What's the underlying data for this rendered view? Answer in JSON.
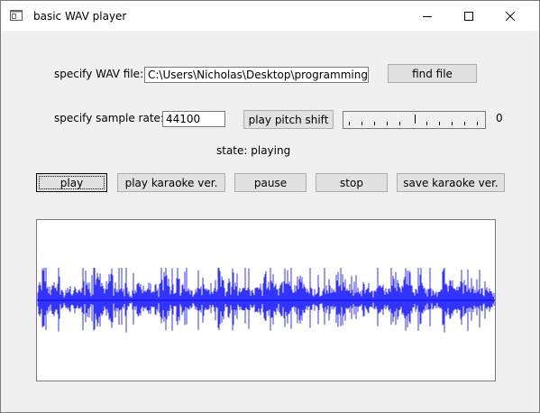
{
  "window": {
    "title": "basic WAV player",
    "controls": [
      "minimize-icon",
      "maximize-icon",
      "close-icon"
    ]
  },
  "file_row": {
    "label": "specify WAV file:",
    "path_value": "C:\\Users\\Nicholas\\Desktop\\programming\\b",
    "find_button": "find file"
  },
  "rate_row": {
    "label": "specify sample rate:",
    "rate_value": "44100",
    "pitch_button": "play pitch shift",
    "pitch_scale_value": "0"
  },
  "status": {
    "text": "state: playing"
  },
  "controls": {
    "play": "play",
    "play_karaoke": "play karaoke ver.",
    "pause": "pause",
    "stop": "stop",
    "save_karaoke": "save karaoke ver."
  },
  "waveform": {
    "color": "#0000ff",
    "background": "#ffffff"
  }
}
